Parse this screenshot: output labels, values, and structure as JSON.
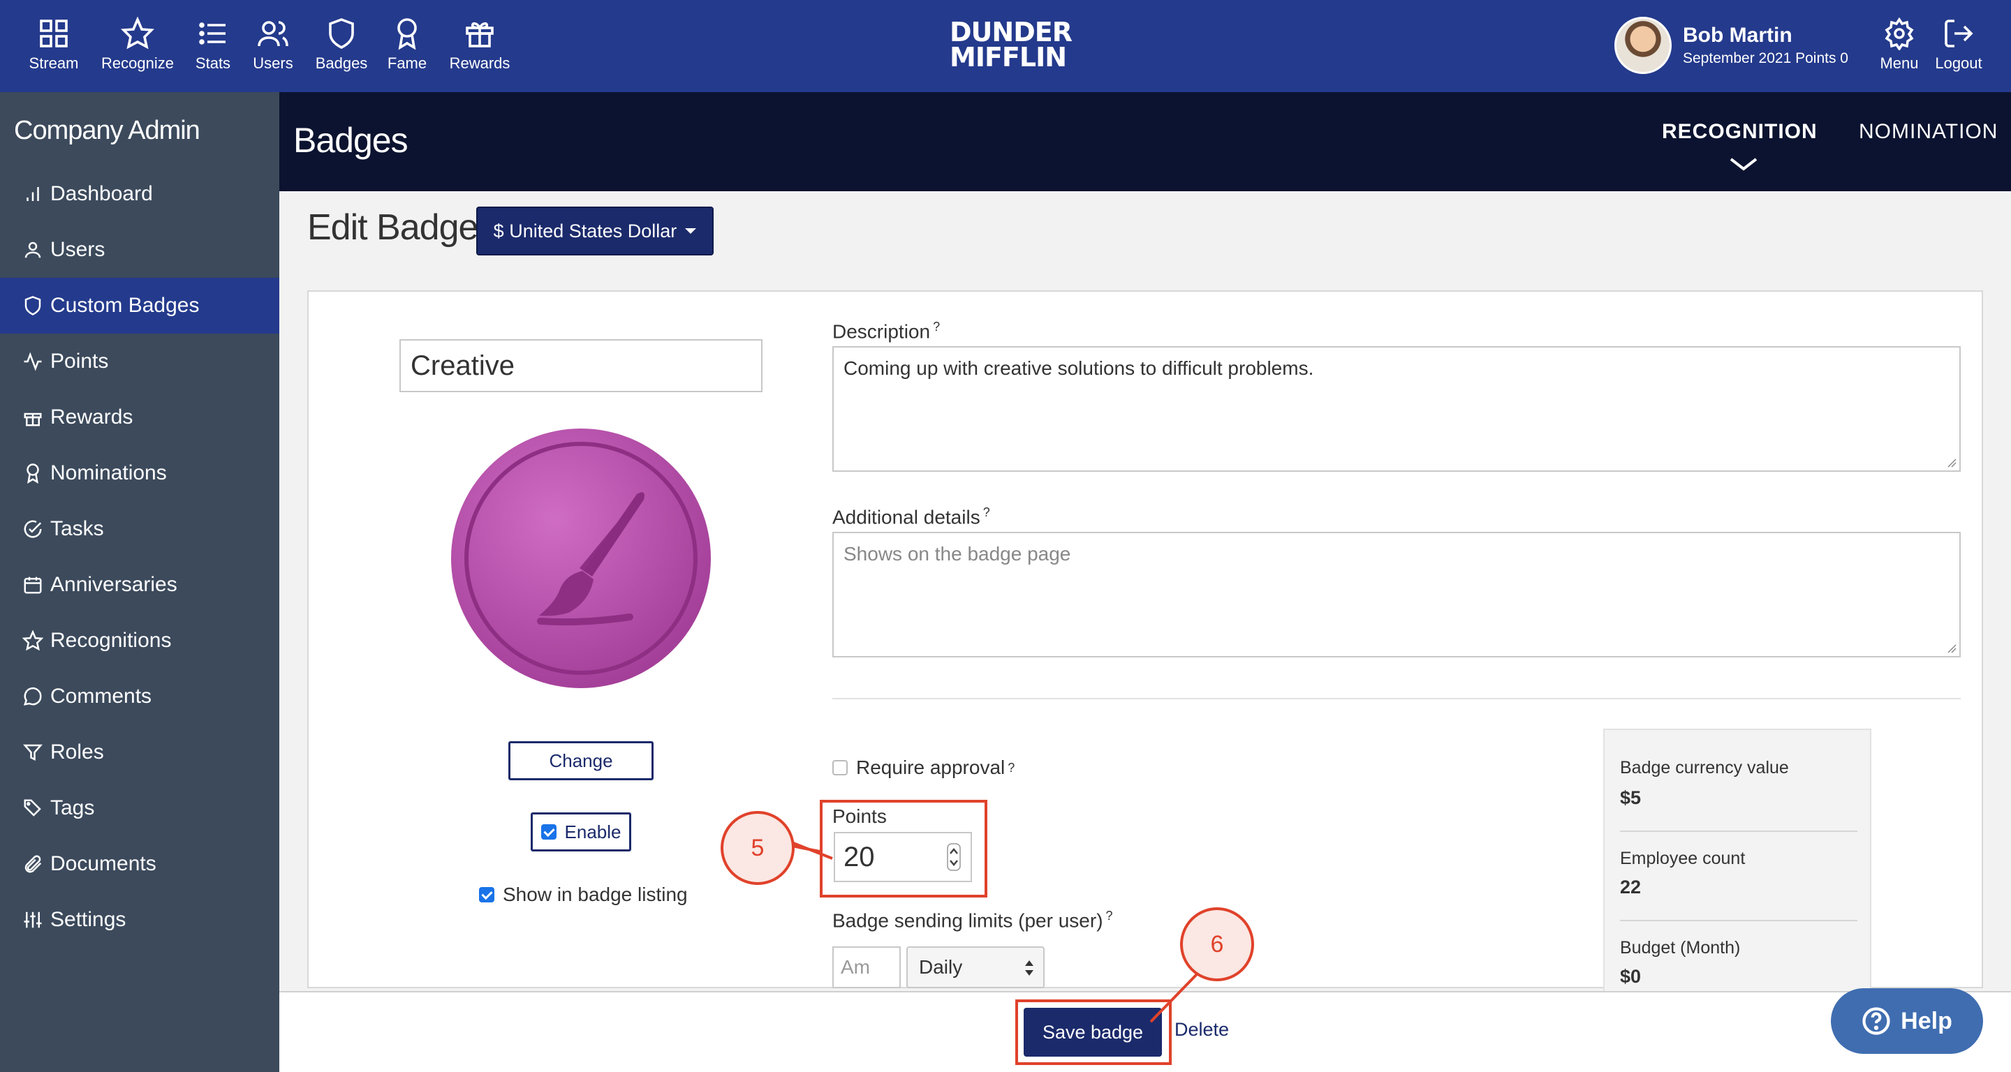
{
  "topnav": {
    "items": [
      {
        "label": "Stream",
        "icon": "grid-icon"
      },
      {
        "label": "Recognize",
        "icon": "star-icon"
      },
      {
        "label": "Stats",
        "icon": "list-icon"
      },
      {
        "label": "Users",
        "icon": "users-icon"
      },
      {
        "label": "Badges",
        "icon": "shield-icon"
      },
      {
        "label": "Fame",
        "icon": "award-icon"
      },
      {
        "label": "Rewards",
        "icon": "gift-icon"
      }
    ],
    "logo_line1": "DUNDER",
    "logo_line2": "MIFFLIN",
    "user_name": "Bob Martin",
    "user_sub": "September 2021 Points 0",
    "menu_label": "Menu",
    "logout_label": "Logout"
  },
  "sidebar": {
    "title": "Company Admin",
    "items": [
      {
        "label": "Dashboard",
        "icon": "bar-chart-icon"
      },
      {
        "label": "Users",
        "icon": "user-icon"
      },
      {
        "label": "Custom Badges",
        "icon": "shield-icon",
        "active": true
      },
      {
        "label": "Points",
        "icon": "activity-icon"
      },
      {
        "label": "Rewards",
        "icon": "gift-icon"
      },
      {
        "label": "Nominations",
        "icon": "award-icon"
      },
      {
        "label": "Tasks",
        "icon": "check-circle-icon"
      },
      {
        "label": "Anniversaries",
        "icon": "calendar-icon"
      },
      {
        "label": "Recognitions",
        "icon": "star-icon"
      },
      {
        "label": "Comments",
        "icon": "message-circle-icon"
      },
      {
        "label": "Roles",
        "icon": "filter-icon"
      },
      {
        "label": "Tags",
        "icon": "tag-icon"
      },
      {
        "label": "Documents",
        "icon": "paperclip-icon"
      },
      {
        "label": "Settings",
        "icon": "sliders-icon"
      }
    ]
  },
  "header": {
    "title": "Badges",
    "tabs": [
      {
        "label": "RECOGNITION",
        "active": true
      },
      {
        "label": "NOMINATION",
        "active": false
      }
    ]
  },
  "edit": {
    "title": "Edit Badge",
    "currency_label": "$ United States Dollar",
    "badge_name": "Creative",
    "change_label": "Change",
    "enable_label": "Enable",
    "enable_checked": true,
    "show_listing_label": "Show in badge listing",
    "show_listing_checked": true,
    "description_label": "Description",
    "description_value": "Coming up with creative solutions to difficult problems.",
    "additional_label": "Additional details",
    "additional_placeholder": "Shows on the badge page",
    "help_mark": "?",
    "require_label": "Require approval",
    "require_checked": false,
    "points_label": "Points",
    "points_value": "20",
    "limits_label": "Badge sending limits (per user)",
    "amount_placeholder": "Am",
    "period_value": "Daily"
  },
  "summary": {
    "currency_value_label": "Badge currency value",
    "currency_value": "$5",
    "employee_count_label": "Employee count",
    "employee_count": "22",
    "budget_label": "Budget (Month)",
    "budget_value": "$0"
  },
  "footer": {
    "save_label": "Save badge",
    "delete_label": "Delete",
    "help_label": "Help"
  },
  "annotations": {
    "step5": "5",
    "step6": "6",
    "color": "#e0422b"
  },
  "colors": {
    "nav": "#243a8c",
    "sidebar": "#3c4a5c",
    "band": "#0b1330",
    "primary_button": "#1b2a6b",
    "badge": "#b44fa8",
    "help": "#3f6db0"
  }
}
